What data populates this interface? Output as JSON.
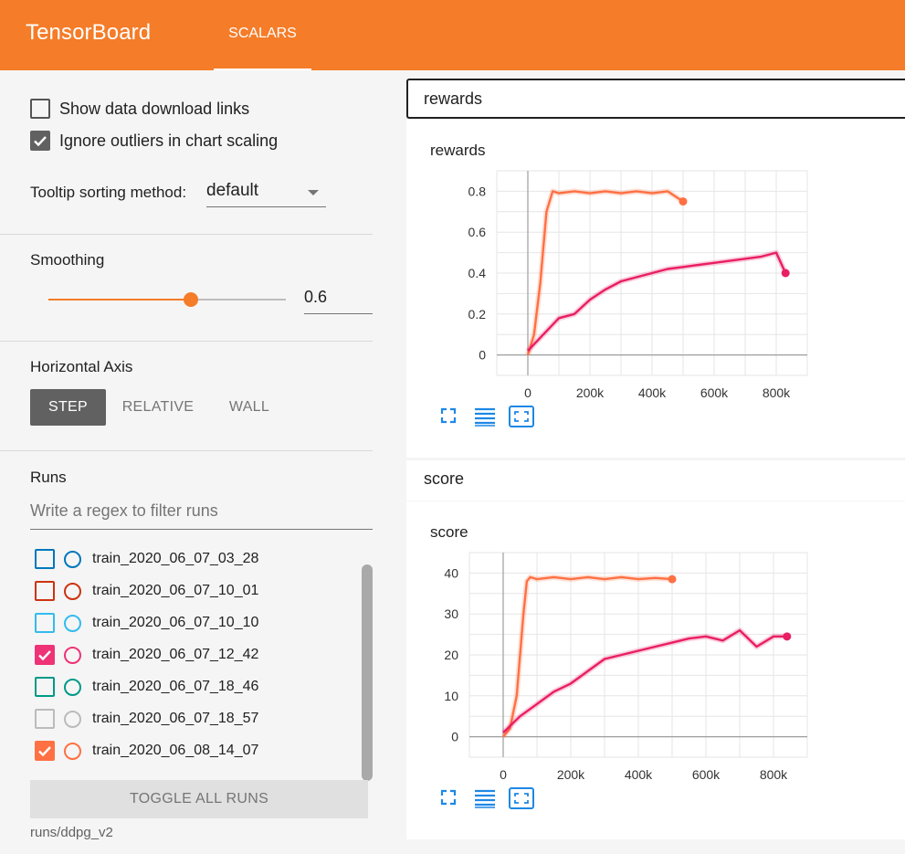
{
  "app": {
    "title": "TensorBoard",
    "tabs": [
      {
        "label": "SCALARS",
        "active": true
      }
    ],
    "accent": "#f57c28"
  },
  "sidebar": {
    "show_download": {
      "label": "Show data download links",
      "checked": false
    },
    "ignore_outliers": {
      "label": "Ignore outliers in chart scaling",
      "checked": true
    },
    "tooltip": {
      "label": "Tooltip sorting method:",
      "value": "default"
    },
    "smoothing": {
      "label": "Smoothing",
      "value": "0.6",
      "fraction": 0.6
    },
    "horizontal_axis": {
      "label": "Horizontal Axis",
      "options": [
        "STEP",
        "RELATIVE",
        "WALL"
      ],
      "selected": "STEP"
    },
    "runs": {
      "label": "Runs",
      "filter_placeholder": "Write a regex to filter runs",
      "items": [
        {
          "name": "train_2020_06_07_03_28",
          "color": "#0077bb",
          "checked": false
        },
        {
          "name": "train_2020_06_07_10_01",
          "color": "#cc3311",
          "checked": false
        },
        {
          "name": "train_2020_06_07_10_10",
          "color": "#33bbee",
          "checked": false
        },
        {
          "name": "train_2020_06_07_12_42",
          "color": "#ee3377",
          "checked": true
        },
        {
          "name": "train_2020_06_07_18_46",
          "color": "#009988",
          "checked": false
        },
        {
          "name": "train_2020_06_07_18_57",
          "color": "#bbbbbb",
          "checked": false
        },
        {
          "name": "train_2020_06_08_14_07",
          "color": "#ff7043",
          "checked": true
        }
      ],
      "toggle_label": "TOGGLE ALL RUNS",
      "logdir": "runs/ddpg_v2"
    }
  },
  "sections": [
    {
      "header": "rewards",
      "card_title": "rewards"
    },
    {
      "header": "score",
      "card_title": "score"
    }
  ],
  "chart_data": [
    {
      "type": "line",
      "title": "rewards",
      "xlabel": "",
      "ylabel": "",
      "xlim": [
        -100000,
        900000
      ],
      "ylim": [
        -0.1,
        0.9
      ],
      "x_ticks": [
        0,
        200000,
        400000,
        600000,
        800000
      ],
      "x_tick_labels": [
        "0",
        "200k",
        "400k",
        "600k",
        "800k"
      ],
      "y_ticks": [
        0,
        0.2,
        0.4,
        0.6,
        0.8
      ],
      "y_tick_labels": [
        "0",
        "0.2",
        "0.4",
        "0.6",
        "0.8"
      ],
      "grid": true,
      "series": [
        {
          "color": "#ff7043",
          "x": [
            0,
            20000,
            40000,
            60000,
            80000,
            100000,
            150000,
            200000,
            250000,
            300000,
            350000,
            400000,
            450000,
            500000
          ],
          "y": [
            0,
            0.1,
            0.35,
            0.7,
            0.8,
            0.79,
            0.8,
            0.79,
            0.8,
            0.79,
            0.8,
            0.79,
            0.8,
            0.75
          ]
        },
        {
          "color": "#e91e63",
          "x": [
            0,
            50000,
            100000,
            150000,
            200000,
            250000,
            300000,
            350000,
            400000,
            450000,
            500000,
            550000,
            600000,
            650000,
            700000,
            750000,
            800000,
            830000
          ],
          "y": [
            0.02,
            0.1,
            0.18,
            0.2,
            0.27,
            0.32,
            0.36,
            0.38,
            0.4,
            0.42,
            0.43,
            0.44,
            0.45,
            0.46,
            0.47,
            0.48,
            0.5,
            0.4
          ]
        }
      ]
    },
    {
      "type": "line",
      "title": "score",
      "xlabel": "",
      "ylabel": "",
      "xlim": [
        -100000,
        900000
      ],
      "ylim": [
        -5,
        45
      ],
      "x_ticks": [
        0,
        200000,
        400000,
        600000,
        800000
      ],
      "x_tick_labels": [
        "0",
        "200k",
        "400k",
        "600k",
        "800k"
      ],
      "y_ticks": [
        0,
        10,
        20,
        30,
        40
      ],
      "y_tick_labels": [
        "0",
        "10",
        "20",
        "30",
        "40"
      ],
      "grid": true,
      "series": [
        {
          "color": "#ff7043",
          "x": [
            0,
            20000,
            40000,
            60000,
            70000,
            80000,
            100000,
            150000,
            200000,
            250000,
            300000,
            350000,
            400000,
            450000,
            500000
          ],
          "y": [
            0,
            2,
            10,
            30,
            38,
            39,
            38.5,
            39,
            38.5,
            39,
            38.5,
            39,
            38.5,
            38.8,
            38.5
          ]
        },
        {
          "color": "#e91e63",
          "x": [
            0,
            50000,
            100000,
            150000,
            200000,
            250000,
            300000,
            350000,
            400000,
            450000,
            500000,
            550000,
            600000,
            650000,
            700000,
            750000,
            800000,
            840000
          ],
          "y": [
            1,
            5,
            8,
            11,
            13,
            16,
            19,
            20,
            21,
            22,
            23,
            24,
            24.5,
            23.5,
            26,
            22,
            24.5,
            24.5
          ]
        }
      ]
    }
  ]
}
